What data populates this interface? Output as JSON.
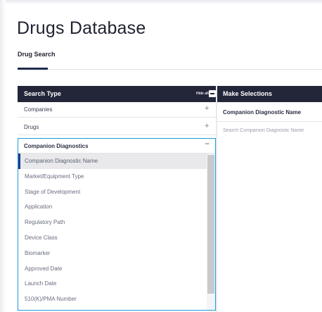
{
  "page": {
    "title": "Drugs Database"
  },
  "tabs": [
    {
      "label": "Drug Search"
    }
  ],
  "left_panel": {
    "header": "Search Type",
    "hide_all_label": "Hide all",
    "sections": [
      {
        "label": "Companies",
        "toggle": "+"
      },
      {
        "label": "Drugs",
        "toggle": "+"
      }
    ],
    "expanded": {
      "label": "Companion Diagnostics",
      "toggle": "−",
      "items": [
        "Companion Diagnostic Name",
        "Market/Equipment Type",
        "Stage of Development",
        "Application",
        "Regulatory Path",
        "Device Class",
        "Biomarker",
        "Approved Date",
        "Launch Date",
        "510(K)/PMA Number"
      ],
      "selected_index": 0
    }
  },
  "right_panel": {
    "header": "Make Selections",
    "field_label": "Companion Diagnostic Name",
    "search_placeholder": "Search Companion Diagnostic Name"
  },
  "colors": {
    "header_bg": "#232639",
    "accent_border": "#1f9bd7",
    "selected_marker": "#1d3d8f"
  }
}
